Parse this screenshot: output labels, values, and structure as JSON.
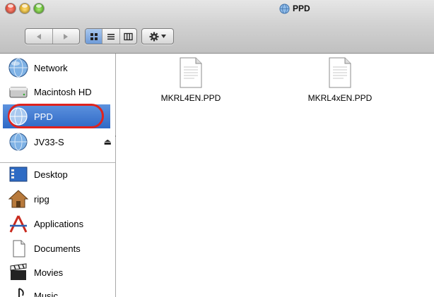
{
  "window": {
    "title": "PPD",
    "title_icon": "network-drive-icon",
    "traffic_lights": {
      "close_color": "#e8412c",
      "minimize_color": "#f2b21a",
      "zoom_color": "#5fbf2b"
    }
  },
  "toolbar": {
    "nav": {
      "back_icon": "back-arrow-icon",
      "forward_icon": "forward-arrow-icon"
    },
    "view_modes": [
      {
        "icon": "icon-view-icon",
        "active": true
      },
      {
        "icon": "list-view-icon",
        "active": false
      },
      {
        "icon": "column-view-icon",
        "active": false
      }
    ],
    "action_icon": "gear-icon"
  },
  "sidebar": {
    "devices": [
      {
        "label": "Network",
        "icon": "network-globe-icon"
      },
      {
        "label": "Macintosh HD",
        "icon": "hard-drive-icon"
      },
      {
        "label": "PPD",
        "icon": "network-volume-icon",
        "selected": true
      },
      {
        "label": "JV33-S",
        "icon": "network-volume-icon",
        "ejectable": true,
        "eject_symbol": "⏏"
      }
    ],
    "places": [
      {
        "label": "Desktop",
        "icon": "desktop-icon"
      },
      {
        "label": "ripg",
        "icon": "home-icon"
      },
      {
        "label": "Applications",
        "icon": "applications-icon"
      },
      {
        "label": "Documents",
        "icon": "documents-icon"
      },
      {
        "label": "Movies",
        "icon": "movies-icon"
      },
      {
        "label": "Music",
        "icon": "music-icon"
      }
    ],
    "selection_color": "#3a75cf",
    "highlight_ring_color": "#e0231d"
  },
  "files": [
    {
      "name": "MKRL4EN.PPD",
      "icon": "document-icon"
    },
    {
      "name": "MKRL4xEN.PPD",
      "icon": "document-icon"
    }
  ]
}
